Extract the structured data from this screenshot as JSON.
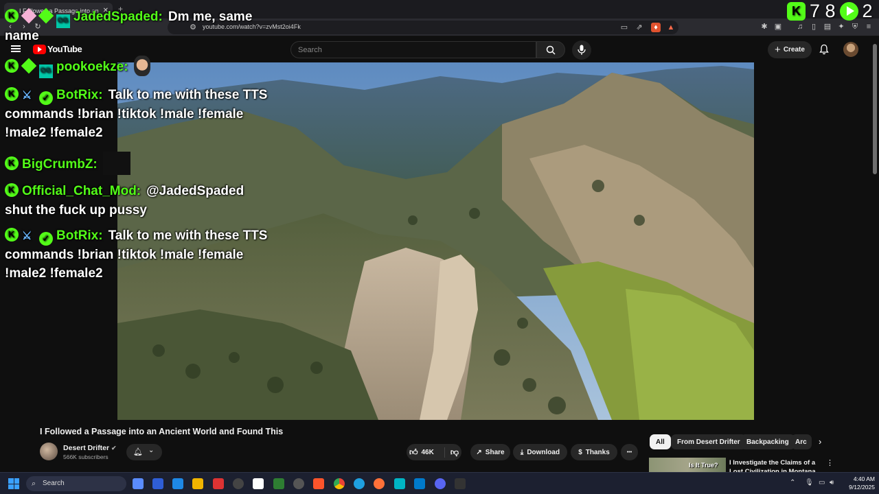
{
  "browser": {
    "tab_title": "I Followed a Passage into an",
    "url": "youtube.com/watch?v=zvMst2oi4Fk"
  },
  "youtube": {
    "logo_text": "YouTube",
    "search_placeholder": "Search",
    "create_label": "Create"
  },
  "chat": [
    {
      "user": "JadedSpaded:",
      "message": "Dm me, same"
    },
    {
      "continuation": "name"
    },
    {
      "user": "pookoekze:",
      "message": ""
    },
    {
      "user": "BotRix:",
      "message": "Talk to me with these TTS",
      "line2": "commands !brian !tiktok !male !female",
      "line3": "!male2 !female2"
    },
    {
      "user": "BigCrumbZ:",
      "message": ""
    },
    {
      "user": "Official_Chat_Mod:",
      "message": "@JadedSpaded",
      "line2": "shut the fuck up pussy"
    },
    {
      "user": "BotRix:",
      "message": "Talk to me with these TTS",
      "line2": "commands !brian !tiktok !male !female",
      "line3": "!male2 !female2"
    }
  ],
  "stream_counters": {
    "viewers": "7 8",
    "followers": "2"
  },
  "video": {
    "title": "I Followed a Passage into an Ancient World and Found This",
    "channel": "Desert Drifter",
    "subscribers": "566K subscribers",
    "likes": "46K",
    "share_label": "Share",
    "download_label": "Download",
    "thanks_label": "Thanks",
    "more_label": "•••"
  },
  "chips": [
    "All",
    "From Desert Drifter",
    "Backpacking",
    "Arc"
  ],
  "recommended": {
    "thumb_text": "Is It True?",
    "title": "I Investigate the Claims of a Lost Civilization in Montana"
  },
  "taskbar": {
    "search_label": "Search",
    "time": "4:40 AM",
    "date": "9/12/2025"
  },
  "colors": {
    "kick_green": "#53fc18",
    "youtube_red": "#ff0000",
    "bg": "#0f0f0f"
  }
}
